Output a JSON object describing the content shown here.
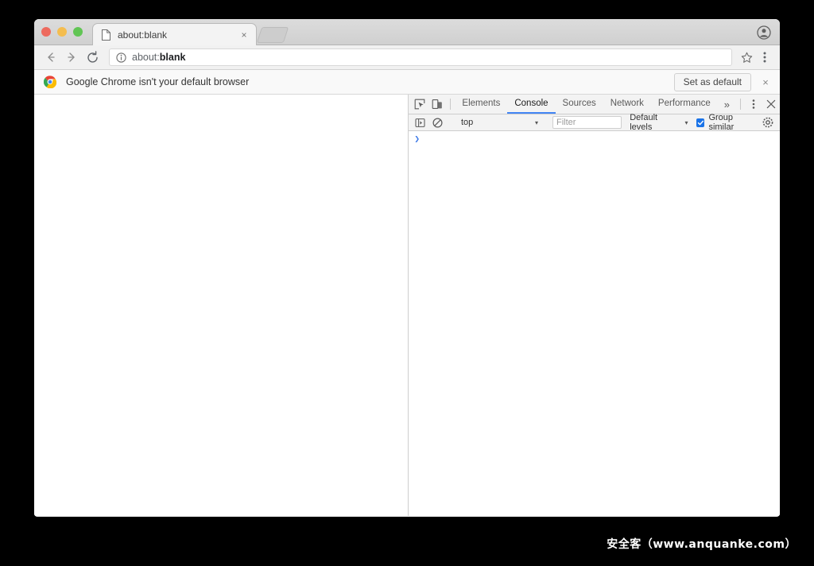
{
  "window": {
    "traffic_lights": [
      {
        "name": "close",
        "color": "#ed6a5e"
      },
      {
        "name": "minimize",
        "color": "#f4bd4f"
      },
      {
        "name": "maximize",
        "color": "#61c554"
      }
    ]
  },
  "tab_strip": {
    "active_tab": {
      "title": "about:blank",
      "favicon": "page-icon",
      "close_glyph": "×"
    },
    "new_tab_label": "",
    "profile_icon": "account-circle-icon"
  },
  "nav_toolbar": {
    "back_glyph": "←",
    "forward_glyph": "→",
    "reload_glyph": "↻",
    "page_info_icon": "info-circle-icon",
    "url_prefix": "about:",
    "url_emphasis": "blank",
    "url_full": "about:blank",
    "star_icon": "star-outline-icon",
    "menu_icon": "three-dots-vertical-icon"
  },
  "infobar": {
    "logo": "chrome-logo-icon",
    "message": "Google Chrome isn't your default browser",
    "action_label": "Set as default",
    "close_glyph": "×"
  },
  "devtools": {
    "left_icons": [
      {
        "name": "inspect-element-icon"
      },
      {
        "name": "device-toolbar-icon"
      }
    ],
    "tabs": [
      {
        "label": "Elements",
        "selected": false
      },
      {
        "label": "Console",
        "selected": true
      },
      {
        "label": "Sources",
        "selected": false
      },
      {
        "label": "Network",
        "selected": false
      },
      {
        "label": "Performance",
        "selected": false
      }
    ],
    "overflow_glyph": "»",
    "more_icon": "three-dots-vertical-icon",
    "close_glyph": "✕",
    "accent_color": "#4285f4",
    "console_toolbar": {
      "sidebar_toggle_icon": "console-sidebar-icon",
      "clear_console_icon": "clear-console-icon",
      "context": "top",
      "context_caret": "▾",
      "filter_placeholder": "Filter",
      "filter_value": "",
      "levels_label": "Default levels",
      "levels_caret": "▾",
      "group_similar_label": "Group similar",
      "group_similar_checked": true,
      "settings_icon": "gear-icon"
    },
    "console": {
      "prompt_glyph": "❯",
      "input_value": "",
      "messages": []
    }
  },
  "watermark": {
    "text": "安全客（www.anquanke.com）"
  }
}
